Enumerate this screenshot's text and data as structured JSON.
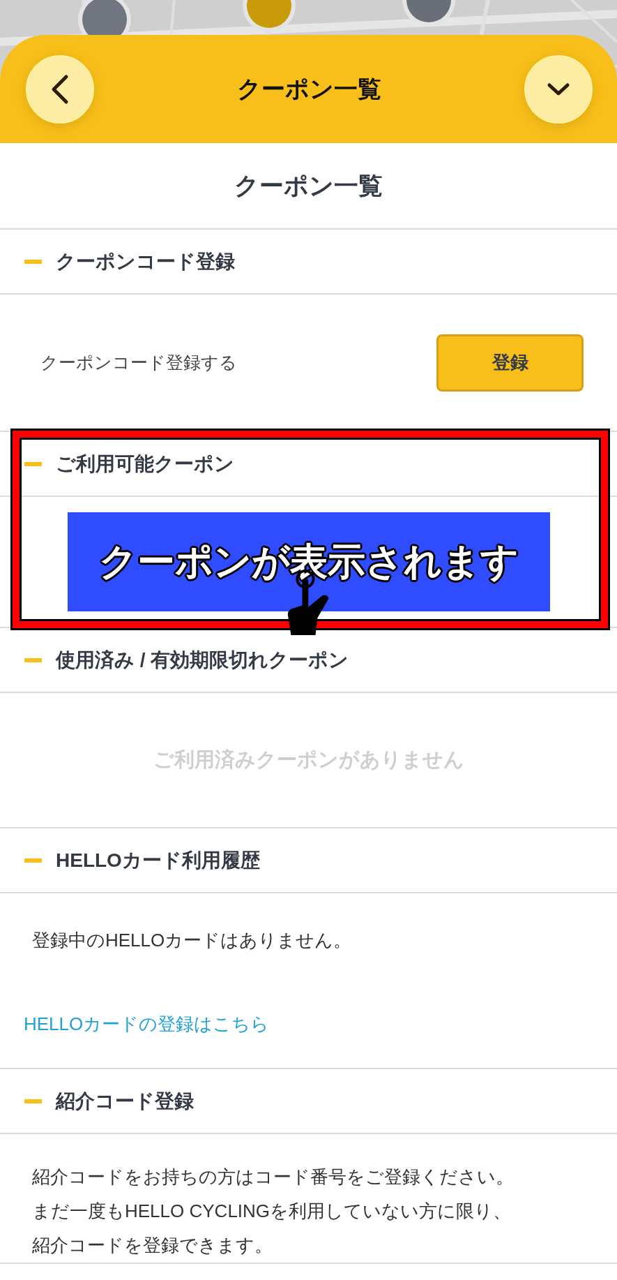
{
  "header": {
    "title": "クーポン一覧"
  },
  "page_title": "クーポン一覧",
  "sections": [
    {
      "kind": "code",
      "heading": "クーポンコード登録",
      "label": "クーポンコード登録する",
      "button": "登録"
    },
    {
      "kind": "highlight",
      "heading": "ご利用可能クーポン",
      "banner": "クーポンが表示されます"
    },
    {
      "kind": "empty",
      "heading": "使用済み / 有効期限切れクーポン",
      "message": "ご利用済みクーポンがありません"
    },
    {
      "kind": "card",
      "heading": "HELLOカード利用履歴",
      "message": "登録中のHELLOカードはありません。",
      "link": "HELLOカードの登録はこちら"
    },
    {
      "kind": "text",
      "heading": "紹介コード登録",
      "lines": [
        "紹介コードをお持ちの方はコード番号をご登録ください。",
        "まだ一度もHELLO CYCLINGを利用していない方に限り、",
        "紹介コードを登録できます。"
      ]
    }
  ]
}
